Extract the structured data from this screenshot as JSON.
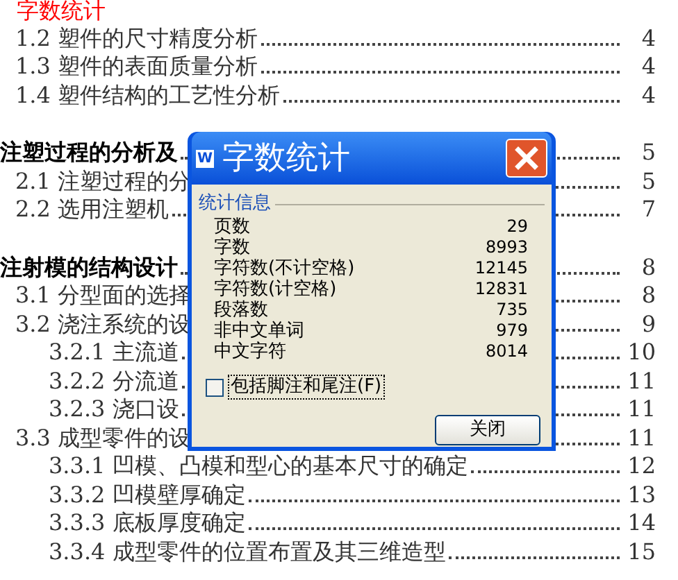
{
  "annotation": "字数统计",
  "toc": [
    {
      "kind": "section",
      "label": "1.2 塑件的尺寸精度分析",
      "page": "4"
    },
    {
      "kind": "section",
      "label": "1.3 塑件的表面质量分析",
      "page": "4"
    },
    {
      "kind": "section",
      "label": "1.4 塑件结构的工艺性分析",
      "page": "4"
    },
    {
      "kind": "gap"
    },
    {
      "kind": "chapter",
      "label": "注塑过程的分析及",
      "page": "5"
    },
    {
      "kind": "section",
      "label": "2.1 注塑过程的分",
      "page": "5"
    },
    {
      "kind": "section",
      "label": "2.2 选用注塑机",
      "page": "7"
    },
    {
      "kind": "gap"
    },
    {
      "kind": "chapter",
      "label": "注射模的结构设计",
      "page": "8"
    },
    {
      "kind": "section",
      "label": "3.1 分型面的选择",
      "page": "8"
    },
    {
      "kind": "section",
      "label": "3.2 浇注系统的设",
      "page": "9"
    },
    {
      "kind": "subsection",
      "label": "3.2.1 主流道",
      "page": "10"
    },
    {
      "kind": "subsection",
      "label": "3.2.2 分流道",
      "page": "11"
    },
    {
      "kind": "subsection",
      "label": "3.2.3 浇口设",
      "page": "11"
    },
    {
      "kind": "section",
      "label": "3.3 成型零件的设",
      "page": "11"
    },
    {
      "kind": "subsection",
      "label": "3.3.1 凹模、凸模和型心的基本尺寸的确定",
      "page": "12"
    },
    {
      "kind": "subsection",
      "label": "3.3.2 凹模壁厚确定",
      "page": "13"
    },
    {
      "kind": "subsection",
      "label": "3.3.3 底板厚度确定",
      "page": "14"
    },
    {
      "kind": "subsection",
      "label": "3.3.4 成型零件的位置布置及其三维造型",
      "page": "15"
    }
  ],
  "dialog": {
    "app_icon": "W",
    "title": "字数统计",
    "group": "统计信息",
    "stats": [
      {
        "label": "页数",
        "value": "29"
      },
      {
        "label": "字数",
        "value": "8993"
      },
      {
        "label": "字符数(不计空格)",
        "value": "12145"
      },
      {
        "label": "字符数(计空格)",
        "value": "12831"
      },
      {
        "label": "段落数",
        "value": "735"
      },
      {
        "label": "非中文单词",
        "value": "979"
      },
      {
        "label": "中文字符",
        "value": "8014"
      }
    ],
    "checkbox": {
      "label": "包括脚注和尾注(F)",
      "checked": false
    },
    "button": "关闭"
  }
}
